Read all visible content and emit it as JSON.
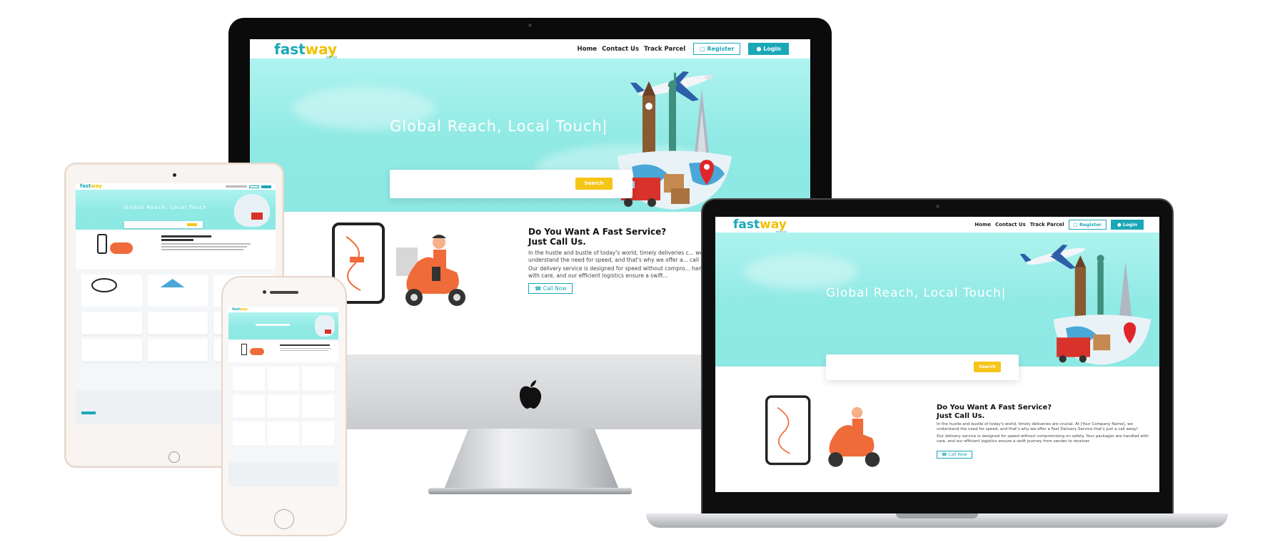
{
  "site": {
    "logo": {
      "part1": "fast",
      "part2": "way",
      "sub": "parcel"
    },
    "nav": [
      "Home",
      "Contact Us",
      "Track Parcel"
    ],
    "register_label": "Register",
    "login_label": "Login",
    "hero_title": "Global Reach, Local Touch|",
    "search_button": "Search",
    "service_heading_1": "Do You Want A Fast Service?",
    "service_heading_2": "Just Call Us.",
    "service_text_1": "In the hustle and bustle of today's world, timely deliveries c... we understand the need for speed, and that's why we offer a... call away!",
    "service_text_2": "Our delivery service is designed for speed without compro... handled with care, and our efficient logistics ensure a swift...",
    "laptop_text_1": "In the hustle and bustle of today's world, timely deliveries are crucial. At [Your Company Name], we understand the need for speed, and that's why we offer a Fast Delivery Service that's just a call away!",
    "laptop_text_2": "Our delivery service is designed for speed without compromising on safety. Your packages are handled with care, and our efficient logistics ensure a swift journey from sender to receiver.",
    "call_now": "Call Now",
    "tablet_hero": "Global Reach, Local Touch"
  },
  "colors": {
    "teal": "#1aa8b8",
    "yellow": "#f5c518",
    "hero": "#8ee8e3"
  }
}
